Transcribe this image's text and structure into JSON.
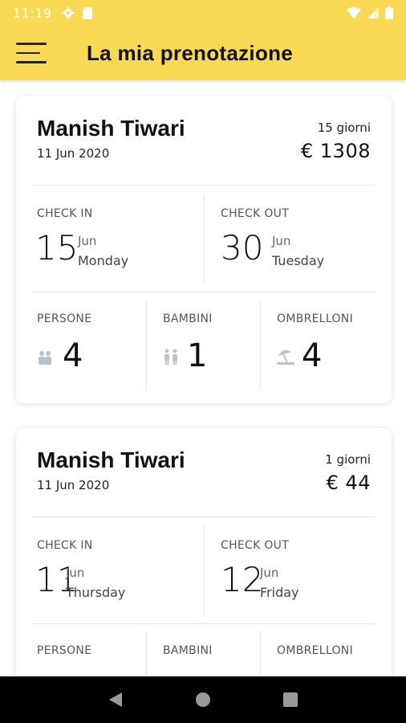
{
  "status_bar": {
    "time": "11:19"
  },
  "app_bar": {
    "title": "La mia prenotazione"
  },
  "labels": {
    "check_in": "CHECK IN",
    "check_out": "CHECK OUT",
    "persons": "PERSONE",
    "children": "BAMBINI",
    "umbrellas": "OMBRELLONI"
  },
  "bookings": [
    {
      "name": "Manish Tiwari",
      "date": "11 Jun 2020",
      "nights": "15 giorni",
      "price": "€ 1308",
      "check_in": {
        "day": "15",
        "month": "Jun",
        "weekday": "Monday"
      },
      "check_out": {
        "day": "30",
        "month": "Jun",
        "weekday": "Tuesday"
      },
      "persons": "4",
      "children": "1",
      "umbrellas": "4"
    },
    {
      "name": "Manish Tiwari",
      "date": "11 Jun 2020",
      "nights": "1 giorni",
      "price": "€ 44",
      "check_in": {
        "day": "11",
        "month": "Jun",
        "weekday": "Thursday"
      },
      "check_out": {
        "day": "12",
        "month": "Jun",
        "weekday": "Friday"
      }
    }
  ],
  "colors": {
    "accent": "#f9d953",
    "icon_grey": "#b9c4ca"
  }
}
